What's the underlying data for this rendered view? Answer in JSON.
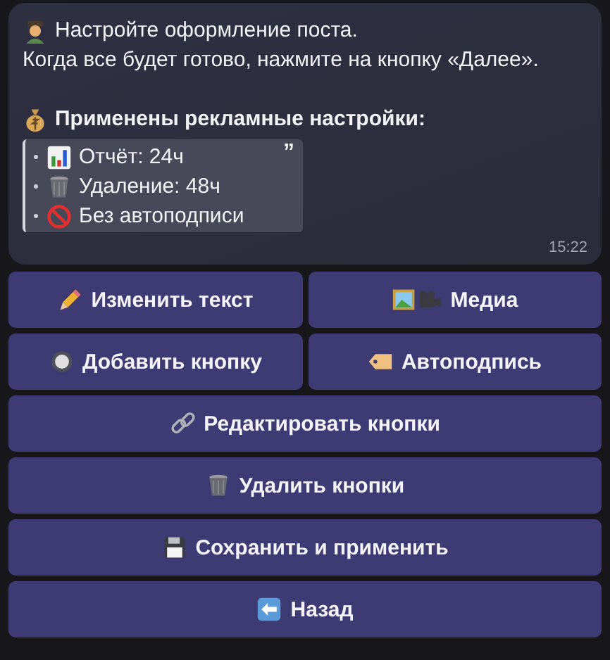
{
  "message": {
    "lines": [
      {
        "kind": "person",
        "text": "Настройте оформление поста."
      },
      {
        "kind": "plain",
        "text": "Когда все будет готово, нажмите на кнопку «Далее»."
      }
    ],
    "heading": {
      "kind": "moneybag",
      "text": "Применены рекламные настройки:"
    },
    "quote": [
      {
        "kind": "chart",
        "text": "Отчёт: 24ч"
      },
      {
        "kind": "trash",
        "text": "Удаление: 48ч"
      },
      {
        "kind": "nosign",
        "text": "Без автоподписи"
      }
    ],
    "quote_mark": "”",
    "time": "15:22"
  },
  "keyboard": [
    [
      {
        "kind": "pencil",
        "label": "Изменить текст"
      },
      {
        "kind": "media",
        "label": "Медиа"
      }
    ],
    [
      {
        "kind": "radio",
        "label": "Добавить кнопку"
      },
      {
        "kind": "tag",
        "label": "Автоподпись"
      }
    ],
    [
      {
        "kind": "link",
        "label": "Редактировать кнопки"
      }
    ],
    [
      {
        "kind": "trash",
        "label": "Удалить кнопки"
      }
    ],
    [
      {
        "kind": "floppy",
        "label": "Сохранить и применить"
      }
    ],
    [
      {
        "kind": "back",
        "label": "Назад"
      }
    ]
  ]
}
